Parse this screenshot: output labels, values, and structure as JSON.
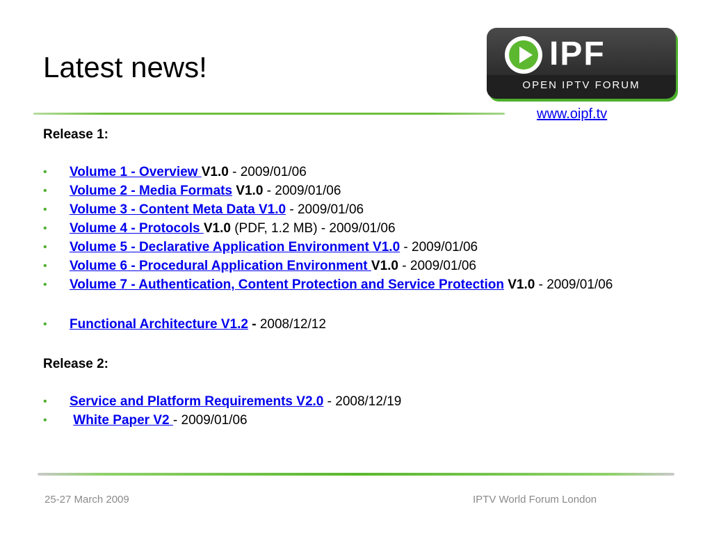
{
  "slide": {
    "title": "Latest news!",
    "url": "www.oipf.tv",
    "logo": {
      "word": "IPF",
      "tagline": "OPEN IPTV FORUM"
    }
  },
  "release1": {
    "heading": "Release 1:",
    "items": [
      {
        "link": "Volume 1 - Overview ",
        "version": "V1.0",
        "rest": " - 2009/01/06"
      },
      {
        "link": "Volume 2 - Media Formats",
        "version": " V1.0",
        "rest": " - 2009/01/06"
      },
      {
        "link": "Volume 3 - Content Meta Data  V1.0",
        "version": "",
        "rest": " - 2009/01/06"
      },
      {
        "link": "Volume 4 - Protocols ",
        "version": "V1.0",
        "rest": " (PDF, 1.2 MB) - 2009/01/06"
      },
      {
        "link": "Volume 5 - Declarative Application Environment V1.0",
        "version": "",
        "rest": " - 2009/01/06"
      },
      {
        "link": "Volume 6 - Procedural  Application Environment ",
        "version": "  V1.0",
        "rest": " - 2009/01/06"
      },
      {
        "link": "Volume 7 - Authentication, Content Protection and Service Protection",
        "version": "  V1.0",
        "rest": " - 2009/01/06"
      }
    ],
    "extra": {
      "link": "Functional Architecture V1.2",
      "sep": " - ",
      "rest": "2008/12/12"
    }
  },
  "release2": {
    "heading": "Release 2:",
    "items": [
      {
        "link": "Service and Platform Requirements V2.0",
        "version": "",
        "rest": " - 2008/12/19"
      },
      {
        "link": "White Paper V2 ",
        "version": "",
        "rest": "- 2009/01/06"
      }
    ]
  },
  "footer": {
    "date": "25-27 March 2009",
    "event": "IPTV World Forum London"
  },
  "colors": {
    "link": "#0000ee",
    "accent_green": "#4cae2c",
    "footer_text": "#8a8a8a"
  }
}
